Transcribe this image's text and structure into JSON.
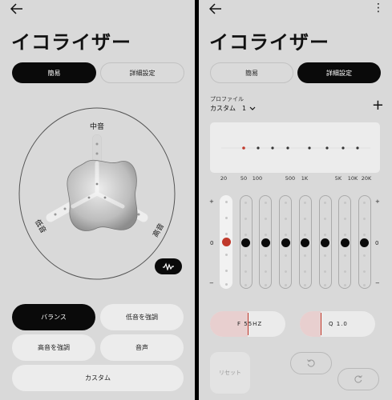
{
  "left": {
    "title": "イコライザー",
    "tabs": [
      "簡易",
      "詳細設定"
    ],
    "dial": {
      "top_label": "中音",
      "left_label": "低音",
      "right_label": "高音"
    },
    "presets": [
      "バランス",
      "低音を強調",
      "高音を強調",
      "音声",
      "カスタム"
    ],
    "selected_preset": "バランス"
  },
  "right": {
    "title": "イコライザー",
    "tabs": [
      "簡易",
      "詳細設定"
    ],
    "profile_label": "プロファイル",
    "profile_value": "カスタム　1",
    "freq_labels": [
      "20",
      "50",
      "100",
      "500",
      "1K",
      "5K",
      "10K",
      "20K"
    ],
    "scale": {
      "plus": "+",
      "zero": "0",
      "minus": "−"
    },
    "bands": 8,
    "selected_band": 1,
    "filter_freq": "F 55HZ",
    "filter_q": "Q 1.0",
    "reset_label": "リセット",
    "accent": "#c0392b"
  }
}
